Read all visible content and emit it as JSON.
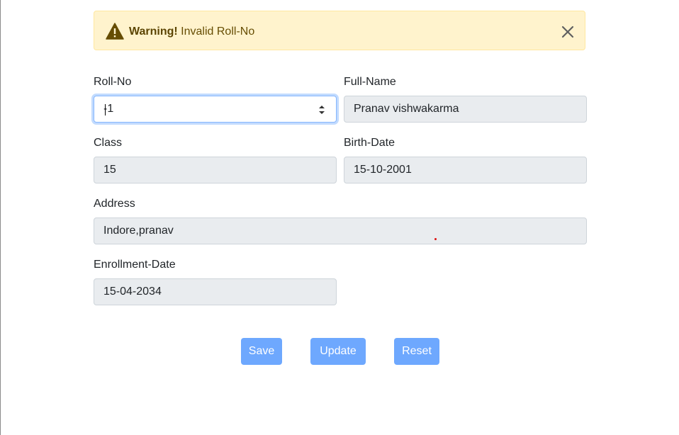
{
  "alert": {
    "title": "Warning!",
    "message": " Invalid Roll-No",
    "icon": "warning-triangle-icon",
    "close_icon": "close-icon"
  },
  "form": {
    "roll_no": {
      "label": "Roll-No",
      "value": "-1"
    },
    "full_name": {
      "label": "Full-Name",
      "value": "Pranav vishwakarma"
    },
    "class": {
      "label": "Class",
      "value": "15"
    },
    "birth_date": {
      "label": "Birth-Date",
      "value": "15-10-2001"
    },
    "address": {
      "label": "Address",
      "value": "Indore,pranav"
    },
    "enrollment_date": {
      "label": "Enrollment-Date",
      "value": "15-04-2034"
    }
  },
  "buttons": {
    "save": "Save",
    "update": "Update",
    "reset": "Reset"
  },
  "colors": {
    "alert_bg": "#fff3cd",
    "alert_text": "#664d03",
    "button_bg": "#6ea8fe",
    "disabled_input_bg": "#e9ecef",
    "focus_border": "#86b7fe"
  }
}
